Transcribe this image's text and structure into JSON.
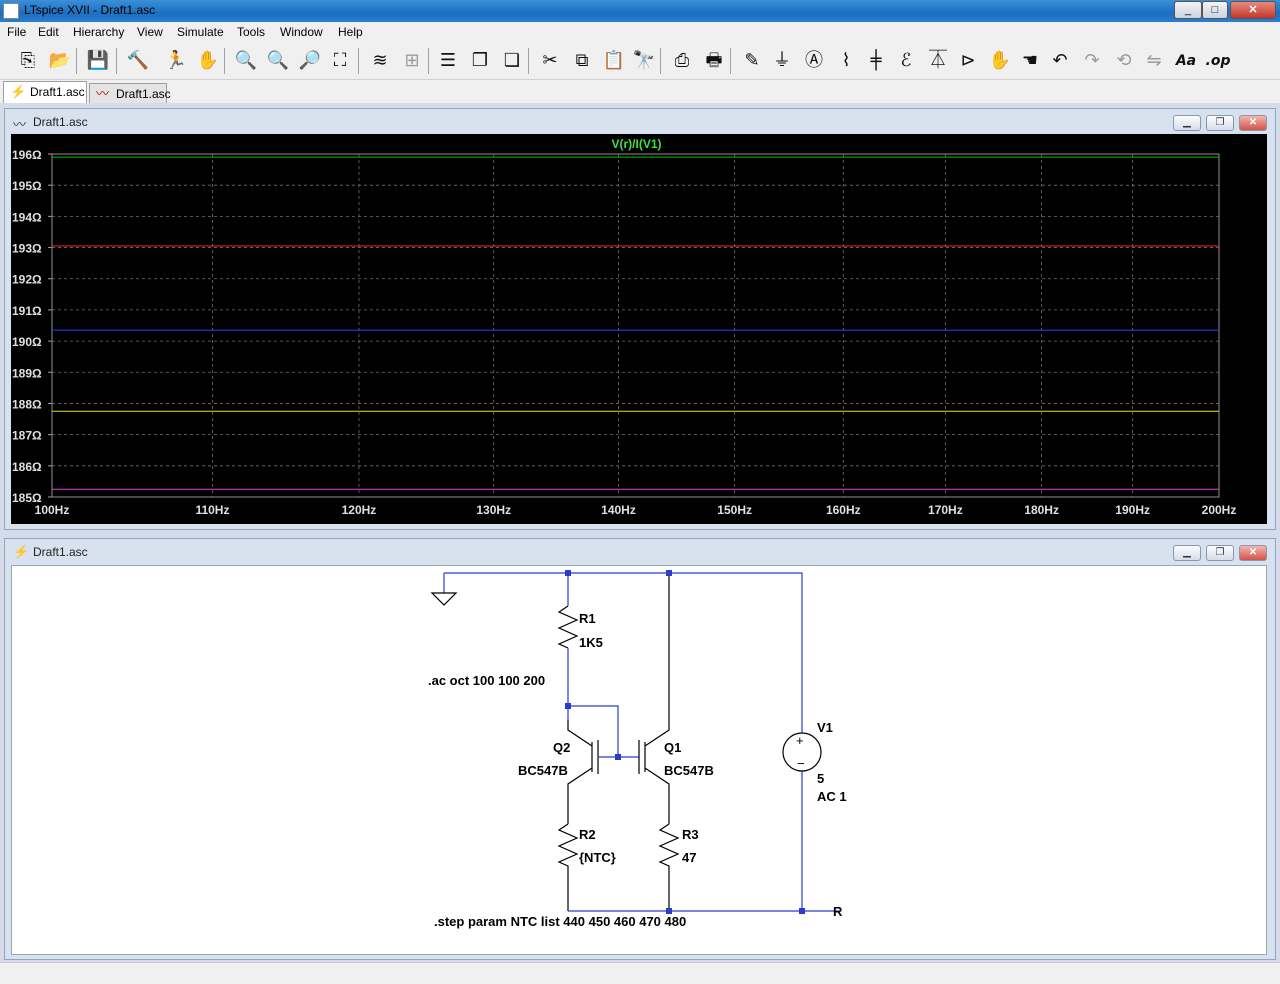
{
  "app": {
    "title": "LTspice XVII - Draft1.asc",
    "window_buttons": [
      "_",
      "□",
      "✕"
    ]
  },
  "menu": [
    "File",
    "Edit",
    "Hierarchy",
    "View",
    "Simulate",
    "Tools",
    "Window",
    "Help"
  ],
  "toolbar": [
    {
      "icon": "new-schematic-icon",
      "glyph": "⎘"
    },
    {
      "icon": "open-icon",
      "glyph": "📂"
    },
    {
      "icon": "save-icon",
      "glyph": "💾"
    },
    {
      "icon": "control-panel-icon",
      "glyph": "🔨"
    },
    {
      "icon": "run-icon",
      "glyph": "🏃"
    },
    {
      "icon": "halt-icon",
      "glyph": "✋",
      "dim": true
    },
    {
      "icon": "zoom-in-icon",
      "glyph": "🔍"
    },
    {
      "icon": "zoom-pan-icon",
      "glyph": "🔍",
      "dim": true
    },
    {
      "icon": "zoom-out-icon",
      "glyph": "🔎"
    },
    {
      "icon": "zoom-fit-icon",
      "glyph": "⛶"
    },
    {
      "icon": "autorange-icon",
      "glyph": "≋"
    },
    {
      "icon": "grid-icon",
      "glyph": "⊞",
      "dim": true
    },
    {
      "icon": "tile-horizontal-icon",
      "glyph": "☰"
    },
    {
      "icon": "cascade-icon",
      "glyph": "❐"
    },
    {
      "icon": "tile-vertical-icon",
      "glyph": "❏"
    },
    {
      "icon": "cut-icon",
      "glyph": "✂"
    },
    {
      "icon": "copy-icon",
      "glyph": "⧉"
    },
    {
      "icon": "paste-icon",
      "glyph": "📋"
    },
    {
      "icon": "find-icon",
      "glyph": "🔭"
    },
    {
      "icon": "print-preview-icon",
      "glyph": "⎙"
    },
    {
      "icon": "print-icon",
      "glyph": "🖶"
    },
    {
      "icon": "wire-icon",
      "glyph": "✎"
    },
    {
      "icon": "ground-icon",
      "glyph": "⏚"
    },
    {
      "icon": "label-net-icon",
      "glyph": "Ⓐ"
    },
    {
      "icon": "resistor-icon",
      "glyph": "⌇"
    },
    {
      "icon": "capacitor-icon",
      "glyph": "╪"
    },
    {
      "icon": "inductor-icon",
      "glyph": "ℰ"
    },
    {
      "icon": "diode-icon",
      "glyph": "⏄"
    },
    {
      "icon": "component-icon",
      "glyph": "⊳"
    },
    {
      "icon": "move-icon",
      "glyph": "✋"
    },
    {
      "icon": "drag-icon",
      "glyph": "☚"
    },
    {
      "icon": "undo-icon",
      "glyph": "↶"
    },
    {
      "icon": "redo-icon",
      "glyph": "↷",
      "dim": true
    },
    {
      "icon": "rotate-icon",
      "glyph": "⟲",
      "dim": true
    },
    {
      "icon": "mirror-icon",
      "glyph": "⇋",
      "dim": true
    },
    {
      "icon": "text-icon",
      "glyph": "Aa"
    },
    {
      "icon": "spice-directive-icon",
      "glyph": ".op"
    }
  ],
  "tabs": [
    {
      "label": "Draft1.asc",
      "icon": "schematic-tab-icon",
      "glyph": "⚡",
      "active": true
    },
    {
      "label": "Draft1.asc",
      "icon": "waveform-tab-icon",
      "glyph": "〰",
      "active": false
    }
  ],
  "plot_window": {
    "title": "Draft1.asc",
    "icon": "waveform-window-icon",
    "trace_label": "V(r)/I(V1)"
  },
  "schematic_window": {
    "title": "Draft1.asc",
    "icon": "schematic-window-icon"
  },
  "chart_data": {
    "type": "line",
    "title": "V(r)/I(V1)",
    "xlabel": "",
    "ylabel": "",
    "x_ticks": [
      "100Hz",
      "110Hz",
      "120Hz",
      "130Hz",
      "140Hz",
      "150Hz",
      "160Hz",
      "170Hz",
      "180Hz",
      "190Hz",
      "200Hz"
    ],
    "y_ticks": [
      "196Ω",
      "195Ω",
      "194Ω",
      "193Ω",
      "192Ω",
      "191Ω",
      "190Ω",
      "189Ω",
      "188Ω",
      "187Ω",
      "186Ω",
      "185Ω"
    ],
    "xlim": [
      100,
      200
    ],
    "ylim": [
      185,
      196
    ],
    "x_scale": "log",
    "grid": true,
    "series": [
      {
        "color": "#00c000",
        "x": [
          100,
          200
        ],
        "y": [
          195.9,
          195.9
        ]
      },
      {
        "color": "#ff2020",
        "x": [
          100,
          200
        ],
        "y": [
          193.05,
          193.05
        ]
      },
      {
        "color": "#2a3cff",
        "x": [
          100,
          200
        ],
        "y": [
          190.35,
          190.35
        ]
      },
      {
        "color": "#e0e020",
        "x": [
          100,
          200
        ],
        "y": [
          187.75,
          187.75
        ]
      },
      {
        "color": "#e040e0",
        "x": [
          100,
          200
        ],
        "y": [
          185.25,
          185.25
        ]
      }
    ],
    "trace_color": "#40e040"
  },
  "schematic": {
    "components": [
      {
        "ref": "R1",
        "value": "1K5"
      },
      {
        "ref": "R2",
        "value": "{NTC}"
      },
      {
        "ref": "R3",
        "value": "47"
      },
      {
        "ref": "Q2",
        "value": "BC547B"
      },
      {
        "ref": "Q1",
        "value": "BC547B"
      },
      {
        "ref": "V1",
        "value": "5",
        "extra": "AC 1"
      }
    ],
    "directives": [
      ".ac oct 100 100 200",
      ".step param NTC list 440 450 460 470 480"
    ],
    "net_label": "R"
  },
  "status": ""
}
